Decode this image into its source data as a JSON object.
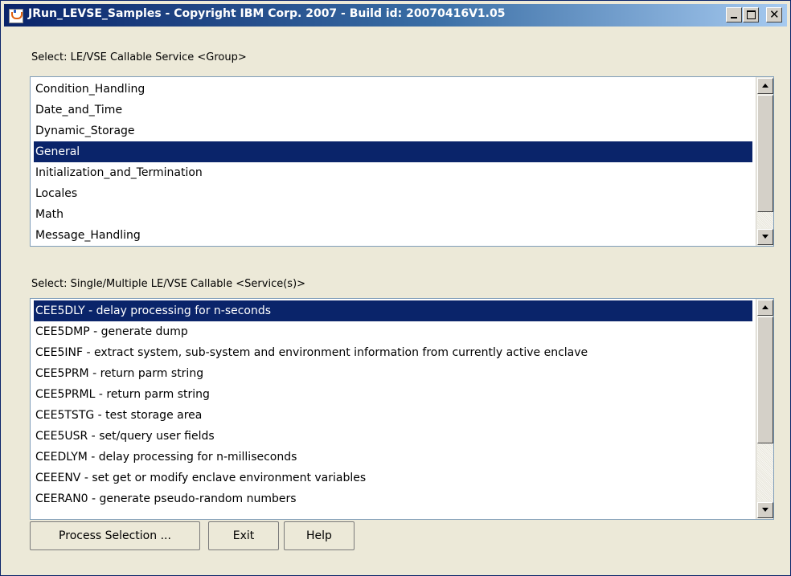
{
  "window": {
    "title": "JRun_LEVSE_Samples - Copyright IBM Corp. 2007 - Build id: 20070416V1.05",
    "icon": "java-coffee-icon",
    "controls": {
      "minimize": "minimize-icon",
      "maximize": "maximize-icon",
      "close_glyph": "✕"
    }
  },
  "groups": {
    "label": "Select:  LE/VSE Callable Service <Group>",
    "items": [
      "Condition_Handling",
      "Date_and_Time",
      "Dynamic_Storage",
      "General",
      "Initialization_and_Termination",
      "Locales",
      "Math",
      "Message_Handling"
    ],
    "selected": "General"
  },
  "services": {
    "label": "Select:  Single/Multiple LE/VSE Callable <Service(s)>",
    "items": [
      "CEE5DLY - delay processing for n-seconds",
      "CEE5DMP - generate dump",
      "CEE5INF - extract system, sub-system and environment information from currently active enclave",
      "CEE5PRM - return parm string",
      "CEE5PRML - return parm string",
      "CEE5TSTG - test storage area",
      "CEE5USR - set/query user fields",
      "CEEDLYM - delay processing for n-milliseconds",
      "CEEENV - set get or modify enclave environment variables",
      "CEERAN0 - generate pseudo-random numbers"
    ],
    "selected": "CEE5DLY - delay processing for n-seconds"
  },
  "buttons": {
    "process": "Process Selection ...",
    "exit": "Exit",
    "help": "Help"
  },
  "colors": {
    "selection_bg": "#0a246a",
    "window_bg": "#ece9d8",
    "title_gradient_start": "#0a246a",
    "title_gradient_end": "#a6caf0"
  }
}
